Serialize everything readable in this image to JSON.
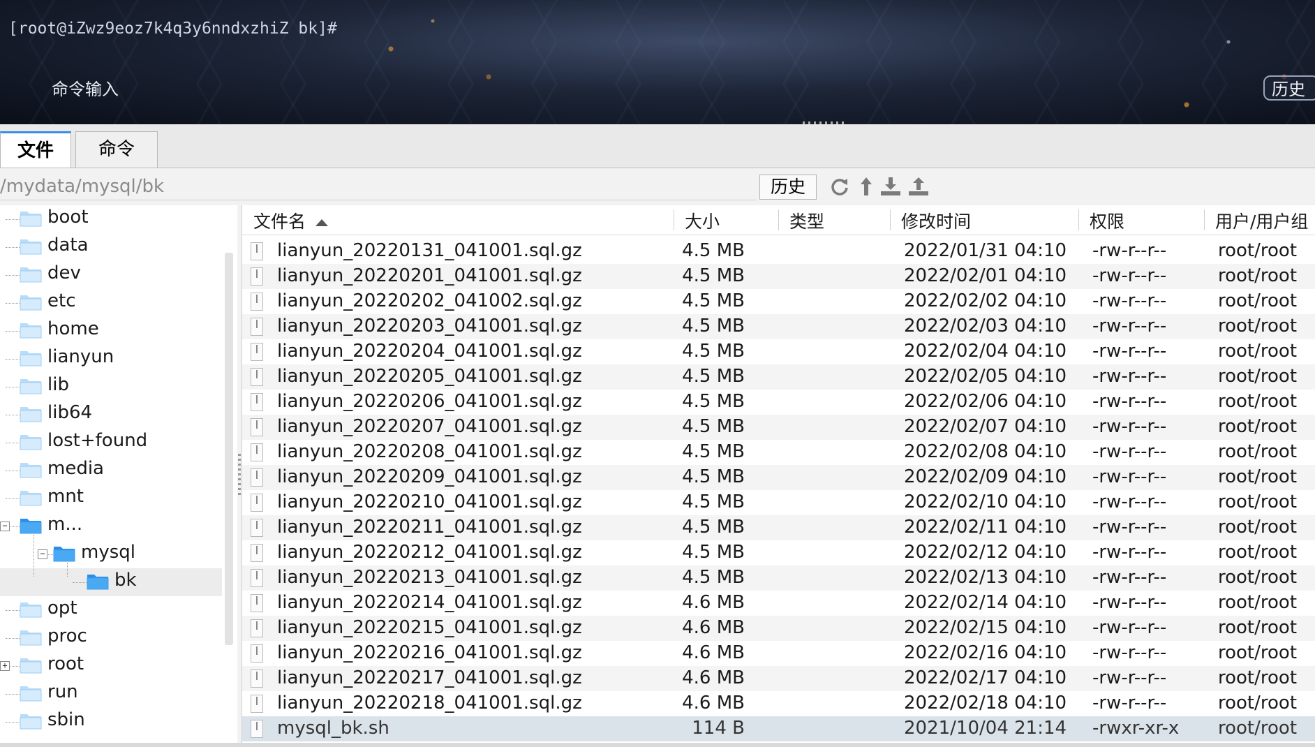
{
  "terminal": {
    "prompt": "[root@iZwz9eoz7k4q3y6nndxzhiZ bk]#",
    "command_input_label": "命令输入",
    "history_button": "历史"
  },
  "tabs": [
    {
      "label": "文件",
      "active": true
    },
    {
      "label": "命令",
      "active": false
    }
  ],
  "path": {
    "value": "/mydata/mysql/bk",
    "history_button": "历史",
    "tools": [
      "refresh-icon",
      "up-directory-icon",
      "download-icon",
      "upload-icon"
    ]
  },
  "tree": {
    "items": [
      {
        "label": "boot",
        "level": 0
      },
      {
        "label": "data",
        "level": 0
      },
      {
        "label": "dev",
        "level": 0
      },
      {
        "label": "etc",
        "level": 0
      },
      {
        "label": "home",
        "level": 0
      },
      {
        "label": "lianyun",
        "level": 0
      },
      {
        "label": "lib",
        "level": 0
      },
      {
        "label": "lib64",
        "level": 0
      },
      {
        "label": "lost+found",
        "level": 0
      },
      {
        "label": "media",
        "level": 0
      },
      {
        "label": "mnt",
        "level": 0
      },
      {
        "label": "m...",
        "level": 0,
        "expanded": true
      },
      {
        "label": "mysql",
        "level": 1,
        "expanded": true
      },
      {
        "label": "bk",
        "level": 2,
        "selected": true
      },
      {
        "label": "opt",
        "level": 0
      },
      {
        "label": "proc",
        "level": 0
      },
      {
        "label": "root",
        "level": 0,
        "collapsed": true
      },
      {
        "label": "run",
        "level": 0
      },
      {
        "label": "sbin",
        "level": 0
      }
    ]
  },
  "columns": [
    "文件名",
    "大小",
    "类型",
    "修改时间",
    "权限",
    "用户/用户组"
  ],
  "files": [
    {
      "name": "lianyun_20220131_041001.sql.gz",
      "size": "4.5 MB",
      "type": "",
      "mtime": "2022/01/31 04:10",
      "perm": "-rw-r--r--",
      "owner": "root/root"
    },
    {
      "name": "lianyun_20220201_041001.sql.gz",
      "size": "4.5 MB",
      "type": "",
      "mtime": "2022/02/01 04:10",
      "perm": "-rw-r--r--",
      "owner": "root/root"
    },
    {
      "name": "lianyun_20220202_041002.sql.gz",
      "size": "4.5 MB",
      "type": "",
      "mtime": "2022/02/02 04:10",
      "perm": "-rw-r--r--",
      "owner": "root/root"
    },
    {
      "name": "lianyun_20220203_041001.sql.gz",
      "size": "4.5 MB",
      "type": "",
      "mtime": "2022/02/03 04:10",
      "perm": "-rw-r--r--",
      "owner": "root/root"
    },
    {
      "name": "lianyun_20220204_041001.sql.gz",
      "size": "4.5 MB",
      "type": "",
      "mtime": "2022/02/04 04:10",
      "perm": "-rw-r--r--",
      "owner": "root/root"
    },
    {
      "name": "lianyun_20220205_041001.sql.gz",
      "size": "4.5 MB",
      "type": "",
      "mtime": "2022/02/05 04:10",
      "perm": "-rw-r--r--",
      "owner": "root/root"
    },
    {
      "name": "lianyun_20220206_041001.sql.gz",
      "size": "4.5 MB",
      "type": "",
      "mtime": "2022/02/06 04:10",
      "perm": "-rw-r--r--",
      "owner": "root/root"
    },
    {
      "name": "lianyun_20220207_041001.sql.gz",
      "size": "4.5 MB",
      "type": "",
      "mtime": "2022/02/07 04:10",
      "perm": "-rw-r--r--",
      "owner": "root/root"
    },
    {
      "name": "lianyun_20220208_041001.sql.gz",
      "size": "4.5 MB",
      "type": "",
      "mtime": "2022/02/08 04:10",
      "perm": "-rw-r--r--",
      "owner": "root/root"
    },
    {
      "name": "lianyun_20220209_041001.sql.gz",
      "size": "4.5 MB",
      "type": "",
      "mtime": "2022/02/09 04:10",
      "perm": "-rw-r--r--",
      "owner": "root/root"
    },
    {
      "name": "lianyun_20220210_041001.sql.gz",
      "size": "4.5 MB",
      "type": "",
      "mtime": "2022/02/10 04:10",
      "perm": "-rw-r--r--",
      "owner": "root/root"
    },
    {
      "name": "lianyun_20220211_041001.sql.gz",
      "size": "4.5 MB",
      "type": "",
      "mtime": "2022/02/11 04:10",
      "perm": "-rw-r--r--",
      "owner": "root/root"
    },
    {
      "name": "lianyun_20220212_041001.sql.gz",
      "size": "4.5 MB",
      "type": "",
      "mtime": "2022/02/12 04:10",
      "perm": "-rw-r--r--",
      "owner": "root/root"
    },
    {
      "name": "lianyun_20220213_041001.sql.gz",
      "size": "4.5 MB",
      "type": "",
      "mtime": "2022/02/13 04:10",
      "perm": "-rw-r--r--",
      "owner": "root/root"
    },
    {
      "name": "lianyun_20220214_041001.sql.gz",
      "size": "4.6 MB",
      "type": "",
      "mtime": "2022/02/14 04:10",
      "perm": "-rw-r--r--",
      "owner": "root/root"
    },
    {
      "name": "lianyun_20220215_041001.sql.gz",
      "size": "4.6 MB",
      "type": "",
      "mtime": "2022/02/15 04:10",
      "perm": "-rw-r--r--",
      "owner": "root/root"
    },
    {
      "name": "lianyun_20220216_041001.sql.gz",
      "size": "4.6 MB",
      "type": "",
      "mtime": "2022/02/16 04:10",
      "perm": "-rw-r--r--",
      "owner": "root/root"
    },
    {
      "name": "lianyun_20220217_041001.sql.gz",
      "size": "4.6 MB",
      "type": "",
      "mtime": "2022/02/17 04:10",
      "perm": "-rw-r--r--",
      "owner": "root/root"
    },
    {
      "name": "lianyun_20220218_041001.sql.gz",
      "size": "4.6 MB",
      "type": "",
      "mtime": "2022/02/18 04:10",
      "perm": "-rw-r--r--",
      "owner": "root/root"
    },
    {
      "name": "mysql_bk.sh",
      "size": "114 B",
      "type": "",
      "mtime": "2021/10/04 21:14",
      "perm": "-rwxr-xr-x",
      "owner": "root/root",
      "selected": true
    }
  ],
  "colors": {
    "accent": "#3d8de8",
    "folder": "#4aa3f0",
    "selected_row": "#dbe3ea"
  }
}
